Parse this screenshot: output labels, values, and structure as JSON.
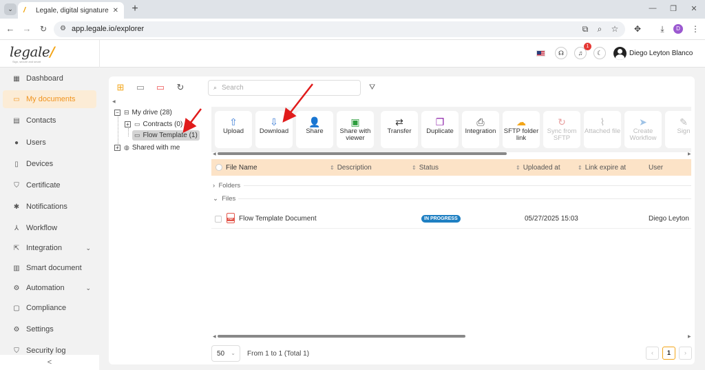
{
  "browser": {
    "tab_title": "Legale, digital signature",
    "url": "app.legale.io/explorer",
    "profile_initial": "D"
  },
  "header": {
    "logo_text": "legale",
    "logo_tagline": "Sign, secure and smart",
    "notification_count": "1",
    "user_name": "Diego Leyton Blanco"
  },
  "sidebar": {
    "items": [
      {
        "label": "Dashboard",
        "icon": "dashboard"
      },
      {
        "label": "My documents",
        "icon": "folder"
      },
      {
        "label": "Contacts",
        "icon": "address-book"
      },
      {
        "label": "Users",
        "icon": "user"
      },
      {
        "label": "Devices",
        "icon": "tablet"
      },
      {
        "label": "Certificate",
        "icon": "shield"
      },
      {
        "label": "Notifications",
        "icon": "bell"
      },
      {
        "label": "Workflow",
        "icon": "sitemap"
      },
      {
        "label": "Integration",
        "icon": "plug"
      },
      {
        "label": "Smart document",
        "icon": "document"
      },
      {
        "label": "Automation",
        "icon": "gear"
      },
      {
        "label": "Compliance",
        "icon": "chat"
      },
      {
        "label": "Settings",
        "icon": "gear"
      },
      {
        "label": "Security log",
        "icon": "shield"
      }
    ],
    "active_item": "My documents",
    "collapse_glyph": "<"
  },
  "explorer": {
    "search_placeholder": "Search",
    "tree": {
      "root": "My drive (28)",
      "children": [
        "Contracts (0)",
        "Flow Template (1)"
      ],
      "shared": "Shared with me"
    },
    "actions": [
      {
        "label": "Upload",
        "icon": "upload",
        "enabled": true
      },
      {
        "label": "Download",
        "icon": "download",
        "enabled": true
      },
      {
        "label": "Share",
        "icon": "share-users",
        "enabled": true
      },
      {
        "label": "Share with viewer",
        "icon": "share-viewer",
        "enabled": true
      },
      {
        "label": "Transfer",
        "icon": "transfer",
        "enabled": true
      },
      {
        "label": "Duplicate",
        "icon": "duplicate",
        "enabled": true
      },
      {
        "label": "Integration",
        "icon": "integration",
        "enabled": true
      },
      {
        "label": "SFTP folder link",
        "icon": "sftp-cloud",
        "enabled": true
      },
      {
        "label": "Sync from SFTP",
        "icon": "sync",
        "enabled": false
      },
      {
        "label": "Attached file",
        "icon": "paperclip",
        "enabled": false
      },
      {
        "label": "Create Workflow",
        "icon": "paper-plane",
        "enabled": false
      },
      {
        "label": "Sign",
        "icon": "sign",
        "enabled": false
      }
    ],
    "columns": [
      "File Name",
      "Description",
      "Status",
      "Uploaded at",
      "Link expire at",
      "User"
    ],
    "groups": {
      "folders": "Folders",
      "files": "Files"
    },
    "files": [
      {
        "name": "Flow Template Document",
        "type": "PDF",
        "description": "",
        "status": "IN PROGRESS",
        "uploaded_at": "05/27/2025 15:03",
        "link_expire_at": "",
        "user": "Diego Leyton Bla"
      }
    ],
    "pagination": {
      "page_size": "50",
      "info": "From 1 to 1 (Total 1)",
      "current_page": "1"
    }
  },
  "colors": {
    "accent": "#f0931e",
    "header_row": "#fce3c7",
    "status_in_progress": "#1e7fc2",
    "annotation_arrow": "#e01b1b"
  }
}
